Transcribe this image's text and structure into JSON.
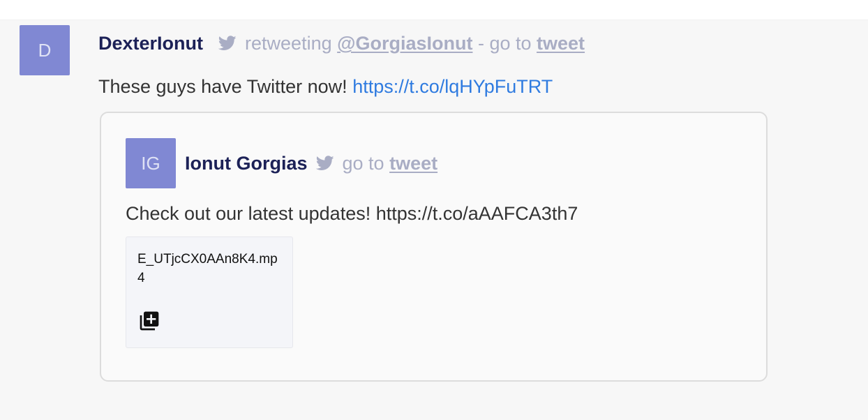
{
  "message": {
    "avatar_initial": "D",
    "author": "DexterIonut",
    "twitter_icon": "twitter-bird-icon",
    "retweeting_label": "retweeting",
    "retweeted_handle": "@GorgiasIonut",
    "separator": "- go to",
    "tweet_link": "tweet",
    "text": "These guys have Twitter now!",
    "link": "https://t.co/lqHYpFuTRT"
  },
  "quoted": {
    "avatar_initials": "IG",
    "author": "Ionut Gorgias",
    "twitter_icon": "twitter-bird-icon",
    "go_to_label": "go to",
    "tweet_link": "tweet",
    "text": "Check out our latest updates! https://t.co/aAAFCA3th7",
    "attachment": {
      "filename": "E_UTjcCX0AAn8K4.mp4",
      "icon": "add-to-library-icon"
    }
  },
  "colors": {
    "avatar": "#8088d3",
    "author": "#1c2157",
    "muted": "#a9adc4",
    "link": "#2f7be0"
  }
}
